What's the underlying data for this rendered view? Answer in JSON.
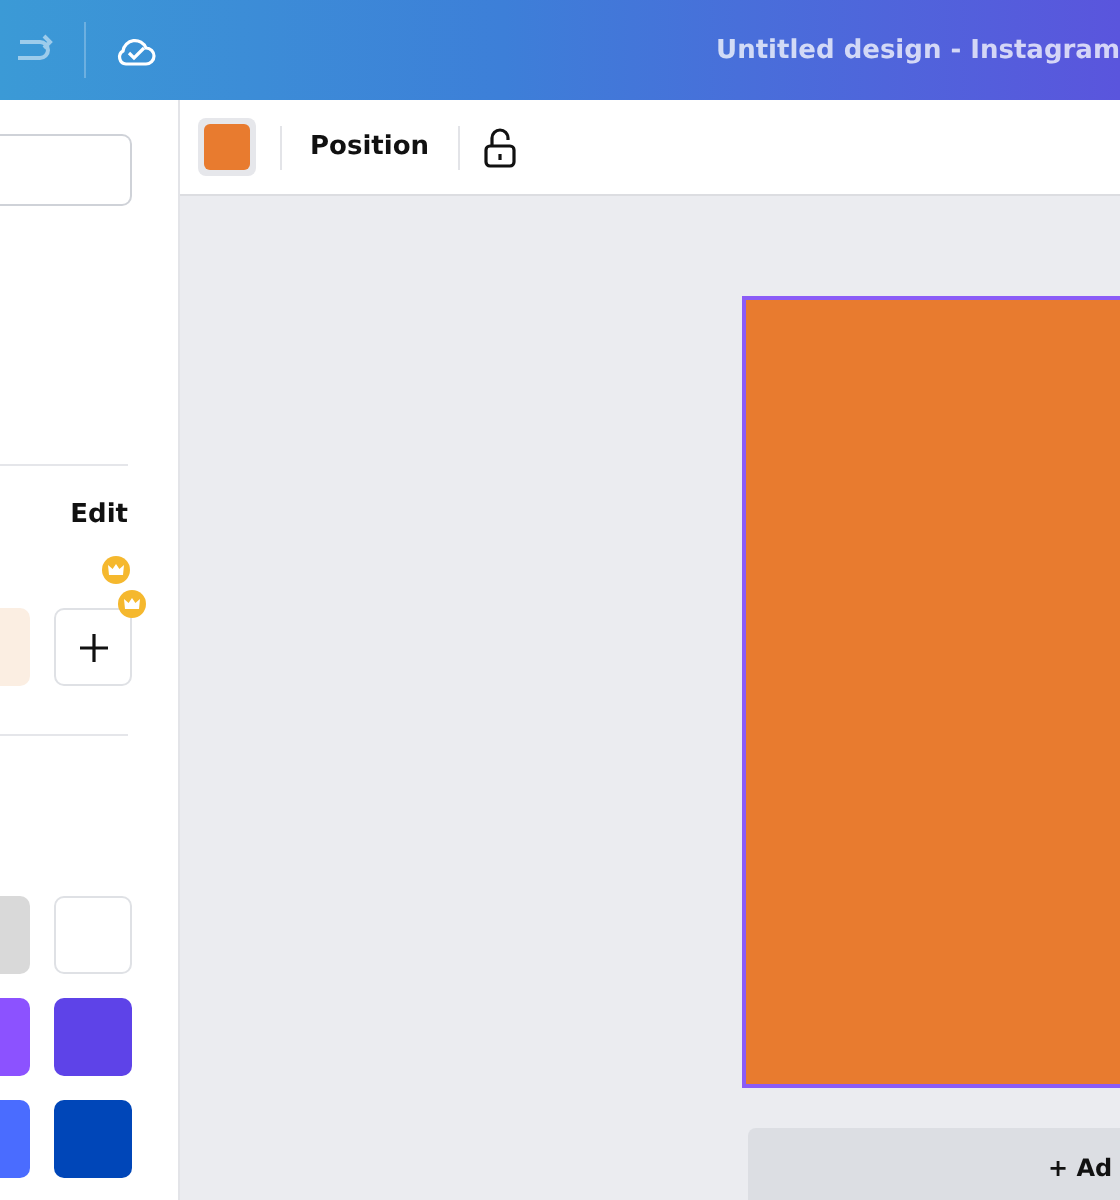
{
  "top_bar": {
    "title": "Untitled design - Instagram"
  },
  "toolbar": {
    "position_label": "Position"
  },
  "side_panel": {
    "edit_label": "Edit",
    "document_colors": [
      {
        "color": "#fbeee2"
      }
    ],
    "palette": [
      {
        "color": "#d9d9d9"
      },
      {
        "color": "#ffffff"
      },
      {
        "color": "#8c52ff"
      },
      {
        "color": "#5e43e8"
      },
      {
        "color": "#4a6cff"
      },
      {
        "color": "#0046b8"
      }
    ]
  },
  "canvas": {
    "selected": true,
    "add_page_label": "+ Ad"
  }
}
